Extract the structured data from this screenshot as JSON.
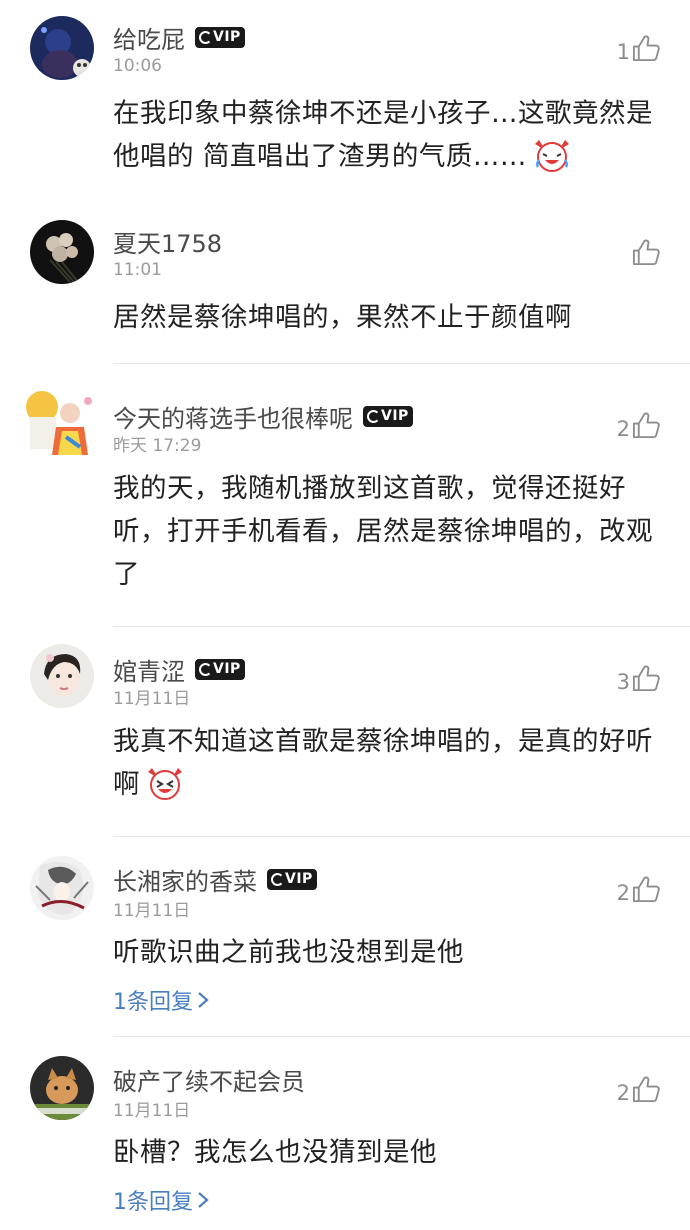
{
  "comments": [
    {
      "name": "给吃屁",
      "vip": true,
      "time": "10:06",
      "likes": "1",
      "text": "在我印象中蔡徐坤不还是小孩子…这歌竟然是他唱的 简直唱出了渣男的气质……",
      "emoji": "laughing-crying-emoji",
      "reply": ""
    },
    {
      "name": "夏天1758",
      "vip": false,
      "time": "11:01",
      "likes": "",
      "text": "居然是蔡徐坤唱的，果然不止于颜值啊",
      "emoji": "",
      "reply": ""
    },
    {
      "name": "今天的蒋选手也很棒呢",
      "vip": true,
      "time": "昨天 17:29",
      "likes": "2",
      "text": "我的天，我随机播放到这首歌，觉得还挺好听，打开手机看看，居然是蔡徐坤唱的，改观了",
      "emoji": "",
      "reply": ""
    },
    {
      "name": "婠青涩",
      "vip": true,
      "time": "11月11日",
      "likes": "3",
      "text": "我真不知道这首歌是蔡徐坤唱的，是真的好听啊",
      "emoji": "laughing-emoji",
      "reply": ""
    },
    {
      "name": "长湘家的香菜",
      "vip": true,
      "time": "11月11日",
      "likes": "2",
      "text": "听歌识曲之前我也没想到是他",
      "emoji": "",
      "reply": "1条回复"
    },
    {
      "name": "破产了续不起会员",
      "vip": false,
      "time": "11月11日",
      "likes": "2",
      "text": "卧槽？我怎么也没猜到是他",
      "emoji": "",
      "reply": "1条回复"
    }
  ],
  "vip_label": "VIP",
  "colors": {
    "name": "#4a4a4a",
    "time": "#9b9b9b",
    "text": "#222222",
    "reply": "#4a7fbf",
    "vip_bg": "#1a1a1a"
  }
}
